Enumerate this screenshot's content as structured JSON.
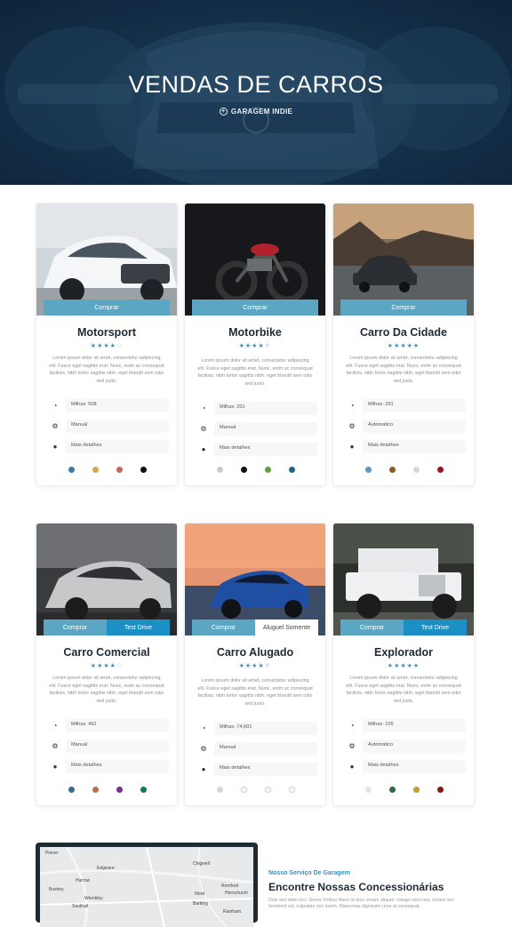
{
  "hero": {
    "title": "VENDAS DE CARROS",
    "subtitle": "GARAGEM INDIE"
  },
  "desc_text": "Lorem ipsum dolor sit amet, consectetur adipiscing elit. Fusce eget sagittis erat. Nunc, enim ac consequat facilisis, nibh tortor sagittis nibh, eget blandit sem odio sed justo.",
  "cards": [
    {
      "title": "Motorsport",
      "buttons": [
        "Comprar"
      ],
      "stars": "★★★★",
      "empty": "☆",
      "features": [
        "Milhas: 508",
        "Manual",
        "Mais detalhes"
      ],
      "colors": [
        "#3c7aa2",
        "#d4a84a",
        "#c9655b",
        "#111111"
      ]
    },
    {
      "title": "Motorbike",
      "buttons": [
        "Comprar"
      ],
      "stars": "★★★★",
      "empty": "⯪",
      "features": [
        "Milhas: 201",
        "Manual",
        "Mais detalhes"
      ],
      "colors": [
        "#c9cbce",
        "#111111",
        "#5f9f3c",
        "#1a6583"
      ]
    },
    {
      "title": "Carro Da Cidade",
      "buttons": [
        "Comprar"
      ],
      "stars": "★★★★★",
      "empty": "",
      "features": [
        "Milhas: 291",
        "Automatico",
        "Mais detalhes"
      ],
      "colors": [
        "#5c97c7",
        "#8e5a22",
        "#d6d8da",
        "#a0131a"
      ]
    },
    {
      "title": "Carro Comercial",
      "buttons": [
        "Comprar",
        "Test Drive"
      ],
      "stars": "★★★★",
      "empty": "☆",
      "features": [
        "Milhas: 491",
        "Manual",
        "Mais detalhes"
      ],
      "colors": [
        "#3c6a8a",
        "#bf6d4a",
        "#7a2d8e",
        "#13795b"
      ]
    },
    {
      "title": "Carro Alugado",
      "buttons": [
        "Comprar",
        "Aluguel Somente"
      ],
      "stars": "★★★★",
      "empty": "⯪",
      "features": [
        "Milhas: 74,601",
        "Manual",
        "Mais detalhes"
      ],
      "colors": [
        "#d6d8da",
        "ring",
        "ring",
        "ring"
      ]
    },
    {
      "title": "Explorador",
      "buttons": [
        "Comprar",
        "Test Drive"
      ],
      "stars": "★★★★★",
      "empty": "",
      "features": [
        "Milhas: 105",
        "Automatico",
        "Mais detalhes"
      ],
      "colors": [
        "#e4e5e6",
        "#2d6a45",
        "#c99a3c",
        "#8c1616"
      ]
    }
  ],
  "service": {
    "kicker": "Nosso Serviço De Garagem",
    "heading": "Encontre Nossas Concessionárias",
    "text": "Duis sed diam orci. Donec finibus libero id arcu ornare aliquet. Integer arcu nisi, ornare nec hendrerit vel, vulputate nec lorem. Maecenas dignissim urna at consequat."
  },
  "map_labels": [
    "Chigwell",
    "Edgware",
    "Harrow",
    "Wembley",
    "Ilford",
    "Romford",
    "Hornchurch",
    "Barking",
    "Rainham",
    "Southall",
    "Bushey",
    "Pinner"
  ]
}
